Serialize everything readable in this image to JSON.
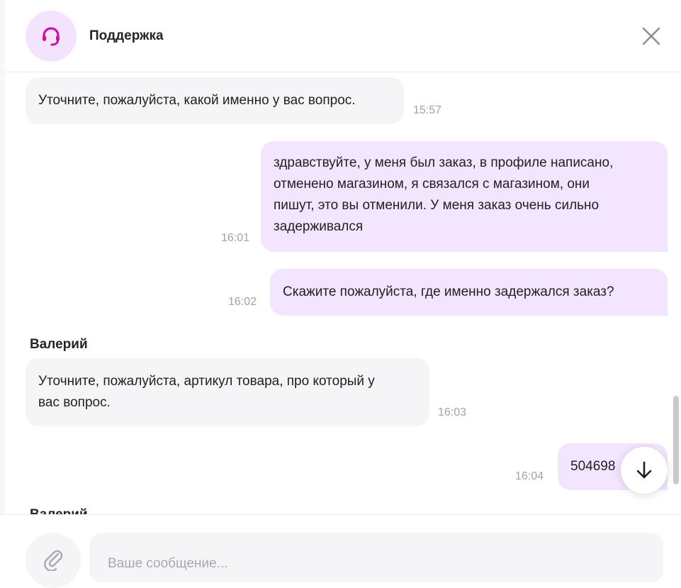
{
  "header": {
    "title": "Поддержка",
    "avatar_icon": "headset-icon",
    "close_icon": "close-icon",
    "accent": "#cb11ab"
  },
  "messages": [
    {
      "direction": "in",
      "text": "Уточните, пожалуйста, какой именно у вас вопрос.",
      "time": "15:57"
    },
    {
      "direction": "out",
      "lines": [
        "здравствуйте, у меня был заказ, в профиле написано,",
        "отменено магазином, я связался с магазином, они",
        "пишут, это вы отменили. У меня заказ очень сильно",
        "задерживался"
      ],
      "time": "16:01"
    },
    {
      "direction": "out",
      "text": "Скажите пожалуйста, где именно задержался заказ?",
      "time": "16:02"
    },
    {
      "direction": "in",
      "sender": "Валерий",
      "lines": [
        "Уточните, пожалуйста, артикул товара, про который у",
        "вас вопрос."
      ],
      "time": "16:03"
    },
    {
      "direction": "out",
      "text": "504698",
      "time": "16:04"
    },
    {
      "direction": "in",
      "sender": "Валерий"
    }
  ],
  "scroll_down_icon": "arrow-down-icon",
  "composer": {
    "placeholder": "Ваше сообщение...",
    "attach_icon": "paperclip-icon"
  }
}
